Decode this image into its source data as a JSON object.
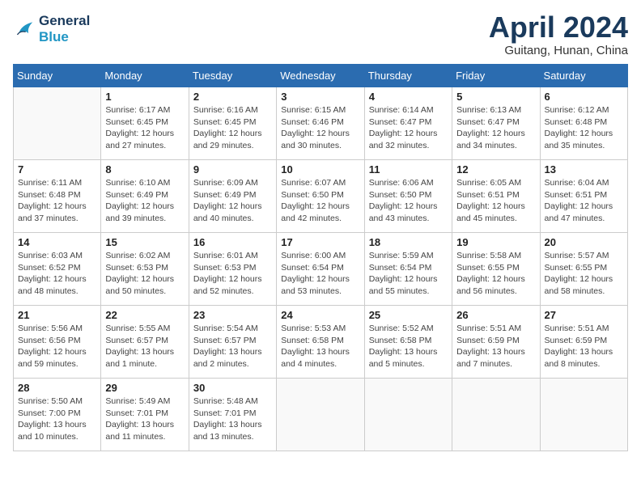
{
  "header": {
    "logo_line1": "General",
    "logo_line2": "Blue",
    "month": "April 2024",
    "location": "Guitang, Hunan, China"
  },
  "weekdays": [
    "Sunday",
    "Monday",
    "Tuesday",
    "Wednesday",
    "Thursday",
    "Friday",
    "Saturday"
  ],
  "weeks": [
    [
      {
        "day": "",
        "info": ""
      },
      {
        "day": "1",
        "info": "Sunrise: 6:17 AM\nSunset: 6:45 PM\nDaylight: 12 hours\nand 27 minutes."
      },
      {
        "day": "2",
        "info": "Sunrise: 6:16 AM\nSunset: 6:45 PM\nDaylight: 12 hours\nand 29 minutes."
      },
      {
        "day": "3",
        "info": "Sunrise: 6:15 AM\nSunset: 6:46 PM\nDaylight: 12 hours\nand 30 minutes."
      },
      {
        "day": "4",
        "info": "Sunrise: 6:14 AM\nSunset: 6:47 PM\nDaylight: 12 hours\nand 32 minutes."
      },
      {
        "day": "5",
        "info": "Sunrise: 6:13 AM\nSunset: 6:47 PM\nDaylight: 12 hours\nand 34 minutes."
      },
      {
        "day": "6",
        "info": "Sunrise: 6:12 AM\nSunset: 6:48 PM\nDaylight: 12 hours\nand 35 minutes."
      }
    ],
    [
      {
        "day": "7",
        "info": "Sunrise: 6:11 AM\nSunset: 6:48 PM\nDaylight: 12 hours\nand 37 minutes."
      },
      {
        "day": "8",
        "info": "Sunrise: 6:10 AM\nSunset: 6:49 PM\nDaylight: 12 hours\nand 39 minutes."
      },
      {
        "day": "9",
        "info": "Sunrise: 6:09 AM\nSunset: 6:49 PM\nDaylight: 12 hours\nand 40 minutes."
      },
      {
        "day": "10",
        "info": "Sunrise: 6:07 AM\nSunset: 6:50 PM\nDaylight: 12 hours\nand 42 minutes."
      },
      {
        "day": "11",
        "info": "Sunrise: 6:06 AM\nSunset: 6:50 PM\nDaylight: 12 hours\nand 43 minutes."
      },
      {
        "day": "12",
        "info": "Sunrise: 6:05 AM\nSunset: 6:51 PM\nDaylight: 12 hours\nand 45 minutes."
      },
      {
        "day": "13",
        "info": "Sunrise: 6:04 AM\nSunset: 6:51 PM\nDaylight: 12 hours\nand 47 minutes."
      }
    ],
    [
      {
        "day": "14",
        "info": "Sunrise: 6:03 AM\nSunset: 6:52 PM\nDaylight: 12 hours\nand 48 minutes."
      },
      {
        "day": "15",
        "info": "Sunrise: 6:02 AM\nSunset: 6:53 PM\nDaylight: 12 hours\nand 50 minutes."
      },
      {
        "day": "16",
        "info": "Sunrise: 6:01 AM\nSunset: 6:53 PM\nDaylight: 12 hours\nand 52 minutes."
      },
      {
        "day": "17",
        "info": "Sunrise: 6:00 AM\nSunset: 6:54 PM\nDaylight: 12 hours\nand 53 minutes."
      },
      {
        "day": "18",
        "info": "Sunrise: 5:59 AM\nSunset: 6:54 PM\nDaylight: 12 hours\nand 55 minutes."
      },
      {
        "day": "19",
        "info": "Sunrise: 5:58 AM\nSunset: 6:55 PM\nDaylight: 12 hours\nand 56 minutes."
      },
      {
        "day": "20",
        "info": "Sunrise: 5:57 AM\nSunset: 6:55 PM\nDaylight: 12 hours\nand 58 minutes."
      }
    ],
    [
      {
        "day": "21",
        "info": "Sunrise: 5:56 AM\nSunset: 6:56 PM\nDaylight: 12 hours\nand 59 minutes."
      },
      {
        "day": "22",
        "info": "Sunrise: 5:55 AM\nSunset: 6:57 PM\nDaylight: 13 hours\nand 1 minute."
      },
      {
        "day": "23",
        "info": "Sunrise: 5:54 AM\nSunset: 6:57 PM\nDaylight: 13 hours\nand 2 minutes."
      },
      {
        "day": "24",
        "info": "Sunrise: 5:53 AM\nSunset: 6:58 PM\nDaylight: 13 hours\nand 4 minutes."
      },
      {
        "day": "25",
        "info": "Sunrise: 5:52 AM\nSunset: 6:58 PM\nDaylight: 13 hours\nand 5 minutes."
      },
      {
        "day": "26",
        "info": "Sunrise: 5:51 AM\nSunset: 6:59 PM\nDaylight: 13 hours\nand 7 minutes."
      },
      {
        "day": "27",
        "info": "Sunrise: 5:51 AM\nSunset: 6:59 PM\nDaylight: 13 hours\nand 8 minutes."
      }
    ],
    [
      {
        "day": "28",
        "info": "Sunrise: 5:50 AM\nSunset: 7:00 PM\nDaylight: 13 hours\nand 10 minutes."
      },
      {
        "day": "29",
        "info": "Sunrise: 5:49 AM\nSunset: 7:01 PM\nDaylight: 13 hours\nand 11 minutes."
      },
      {
        "day": "30",
        "info": "Sunrise: 5:48 AM\nSunset: 7:01 PM\nDaylight: 13 hours\nand 13 minutes."
      },
      {
        "day": "",
        "info": ""
      },
      {
        "day": "",
        "info": ""
      },
      {
        "day": "",
        "info": ""
      },
      {
        "day": "",
        "info": ""
      }
    ]
  ]
}
